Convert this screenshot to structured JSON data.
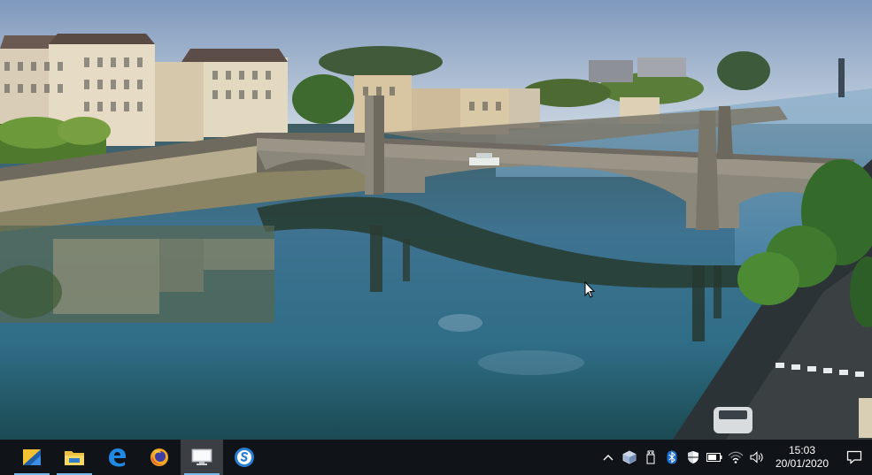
{
  "taskbar": {
    "apps": [
      {
        "name": "sticky-notes-app",
        "icon": "sticky-notes-icon",
        "running": true,
        "active": false
      },
      {
        "name": "file-explorer-app",
        "icon": "folder-icon",
        "running": true,
        "active": false
      },
      {
        "name": "edge-app",
        "icon": "edge-icon",
        "running": false,
        "active": false
      },
      {
        "name": "firefox-app",
        "icon": "firefox-icon",
        "running": false,
        "active": false
      },
      {
        "name": "remote-desktop-app",
        "icon": "monitor-icon",
        "running": true,
        "active": true
      },
      {
        "name": "blue-s-app",
        "icon": "s-circle-icon",
        "running": false,
        "active": false
      }
    ],
    "tray": {
      "time": "15:03",
      "date": "20/01/2020"
    }
  },
  "colors": {
    "taskbar_bg": "#101418",
    "accent": "#76b9ed"
  }
}
